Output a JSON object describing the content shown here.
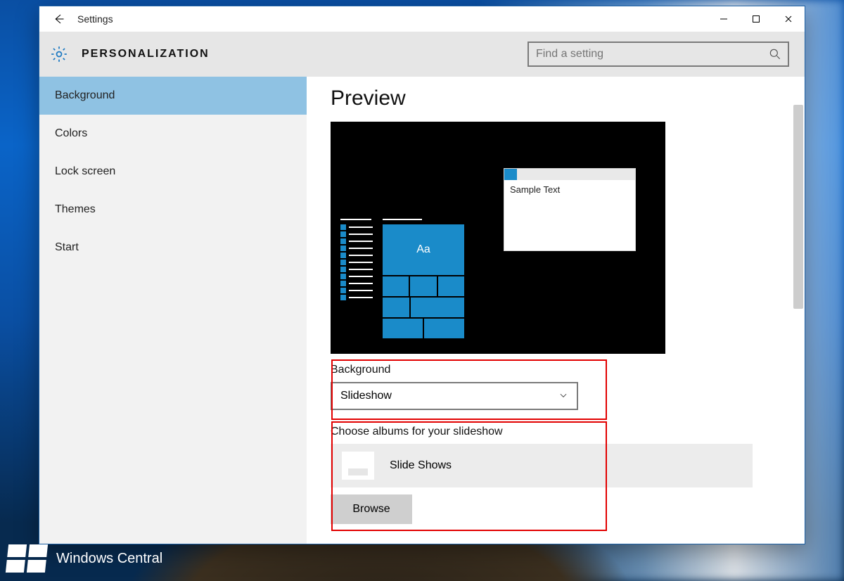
{
  "titlebar": {
    "back_aria": "Back",
    "app_title": "Settings"
  },
  "header": {
    "section_title": "PERSONALIZATION",
    "search_placeholder": "Find a setting"
  },
  "sidebar": {
    "items": [
      {
        "label": "Background",
        "selected": true
      },
      {
        "label": "Colors",
        "selected": false
      },
      {
        "label": "Lock screen",
        "selected": false
      },
      {
        "label": "Themes",
        "selected": false
      },
      {
        "label": "Start",
        "selected": false
      }
    ]
  },
  "content": {
    "preview_heading": "Preview",
    "preview_tile_text": "Aa",
    "preview_sample_window_text": "Sample Text",
    "background_field": {
      "label": "Background",
      "selected_value": "Slideshow"
    },
    "albums_field": {
      "label": "Choose albums for your slideshow",
      "album_name": "Slide Shows",
      "browse_label": "Browse"
    }
  },
  "watermark": {
    "text": "Windows Central"
  }
}
